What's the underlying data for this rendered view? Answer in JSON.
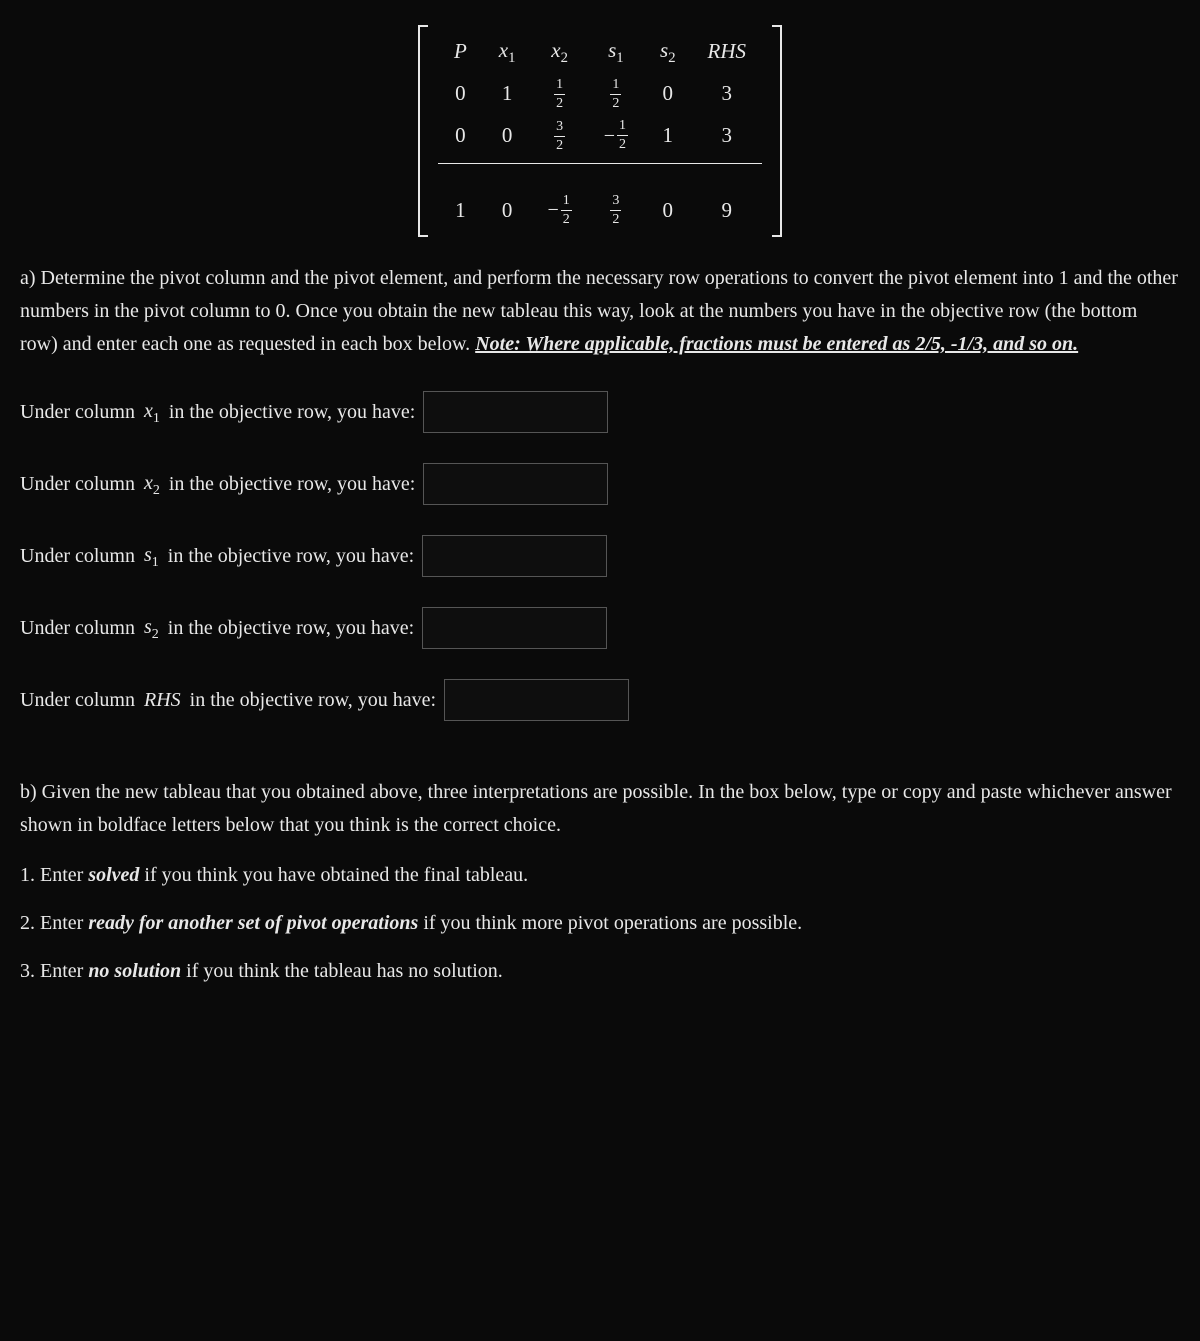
{
  "tableau": {
    "headers": {
      "P": "P",
      "x1": "x",
      "x1_sub": "1",
      "x2": "x",
      "x2_sub": "2",
      "s1": "s",
      "s1_sub": "1",
      "s2": "s",
      "s2_sub": "2",
      "RHS": "RHS"
    },
    "row1": {
      "P": "0",
      "x1": "1",
      "x2_num": "1",
      "x2_den": "2",
      "s1_num": "1",
      "s1_den": "2",
      "s2": "0",
      "RHS": "3"
    },
    "row2": {
      "P": "0",
      "x1": "0",
      "x2_num": "3",
      "x2_den": "2",
      "s1_neg": "−",
      "s1_num": "1",
      "s1_den": "2",
      "s2": "1",
      "RHS": "3"
    },
    "obj": {
      "P": "1",
      "x1": "0",
      "x2_neg": "−",
      "x2_num": "1",
      "x2_den": "2",
      "s1_num": "3",
      "s1_den": "2",
      "s2": "0",
      "RHS": "9"
    }
  },
  "partA": {
    "text1": "a) Determine the pivot column and the pivot element, and perform the necessary row operations to convert the pivot element into 1 and the other numbers in the pivot column to 0. Once you obtain the new tableau this way, look at the numbers you have in the objective row (the bottom row) and enter each one as requested in each box below. ",
    "note": "Note: Where applicable, fractions must be entered as   2/5,   -1/3, and so on."
  },
  "questions": {
    "lead": "Under column ",
    "tail": " in the objective row, you have:",
    "x1_var": "x",
    "x1_sub": "1",
    "x2_var": "x",
    "x2_sub": "2",
    "s1_var": "s",
    "s1_sub": "1",
    "s2_var": "s",
    "s2_sub": "2",
    "rhs_var": "RHS"
  },
  "partB": {
    "text": "b) Given the new tableau that you obtained above, three interpretations are possible. In the box below, type or copy and paste whichever answer shown in boldface letters below that you think is the correct choice.",
    "opt1_lead": "1. Enter  ",
    "opt1_bold": "solved",
    "opt1_tail": "  if you think you have obtained the final tableau.",
    "opt2_lead": "2. Enter  ",
    "opt2_bold": "ready for another set of pivot operations",
    "opt2_tail": "  if you think more pivot operations are possible.",
    "opt3_lead": "3. Enter  ",
    "opt3_bold": "no solution",
    "opt3_tail": "  if you think the tableau has no solution."
  }
}
